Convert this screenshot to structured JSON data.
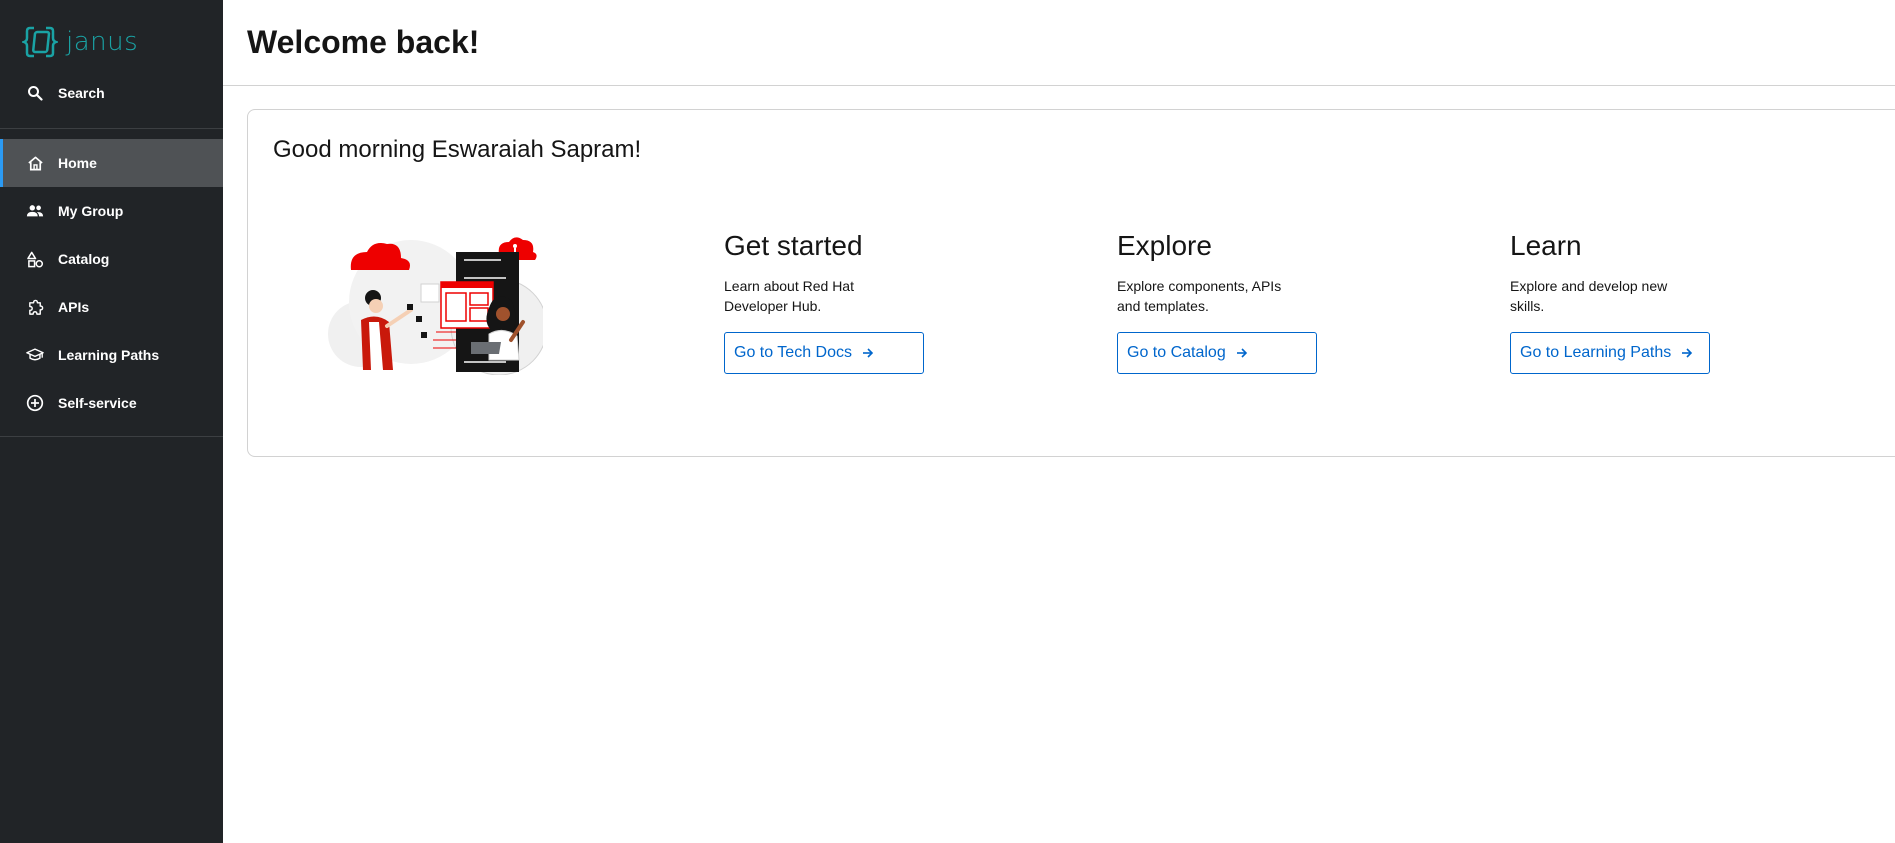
{
  "brand": {
    "name": "janus",
    "accent_color": "#1aa3a5"
  },
  "sidebar": {
    "search_label": "Search",
    "items": [
      {
        "label": "Home",
        "icon": "home-icon",
        "active": true
      },
      {
        "label": "My Group",
        "icon": "group-icon",
        "active": false
      },
      {
        "label": "Catalog",
        "icon": "catalog-icon",
        "active": false
      },
      {
        "label": "APIs",
        "icon": "puzzle-icon",
        "active": false
      },
      {
        "label": "Learning Paths",
        "icon": "graduation-cap-icon",
        "active": false
      },
      {
        "label": "Self-service",
        "icon": "add-circle-icon",
        "active": false
      }
    ]
  },
  "header": {
    "title": "Welcome back!"
  },
  "card": {
    "greeting": "Good morning Eswaraiah Sapram!",
    "sections": [
      {
        "title": "Get started",
        "description": "Learn about Red Hat Developer Hub.",
        "button": "Go to Tech Docs"
      },
      {
        "title": "Explore",
        "description": "Explore components, APIs and templates.",
        "button": "Go to Catalog"
      },
      {
        "title": "Learn",
        "description": "Explore and develop new skills.",
        "button": "Go to Learning Paths"
      }
    ]
  },
  "colors": {
    "sidebar_bg": "#212427",
    "active_item_bg": "#4f5255",
    "link_blue": "#0066cc",
    "illustration_red": "#ee0000"
  }
}
